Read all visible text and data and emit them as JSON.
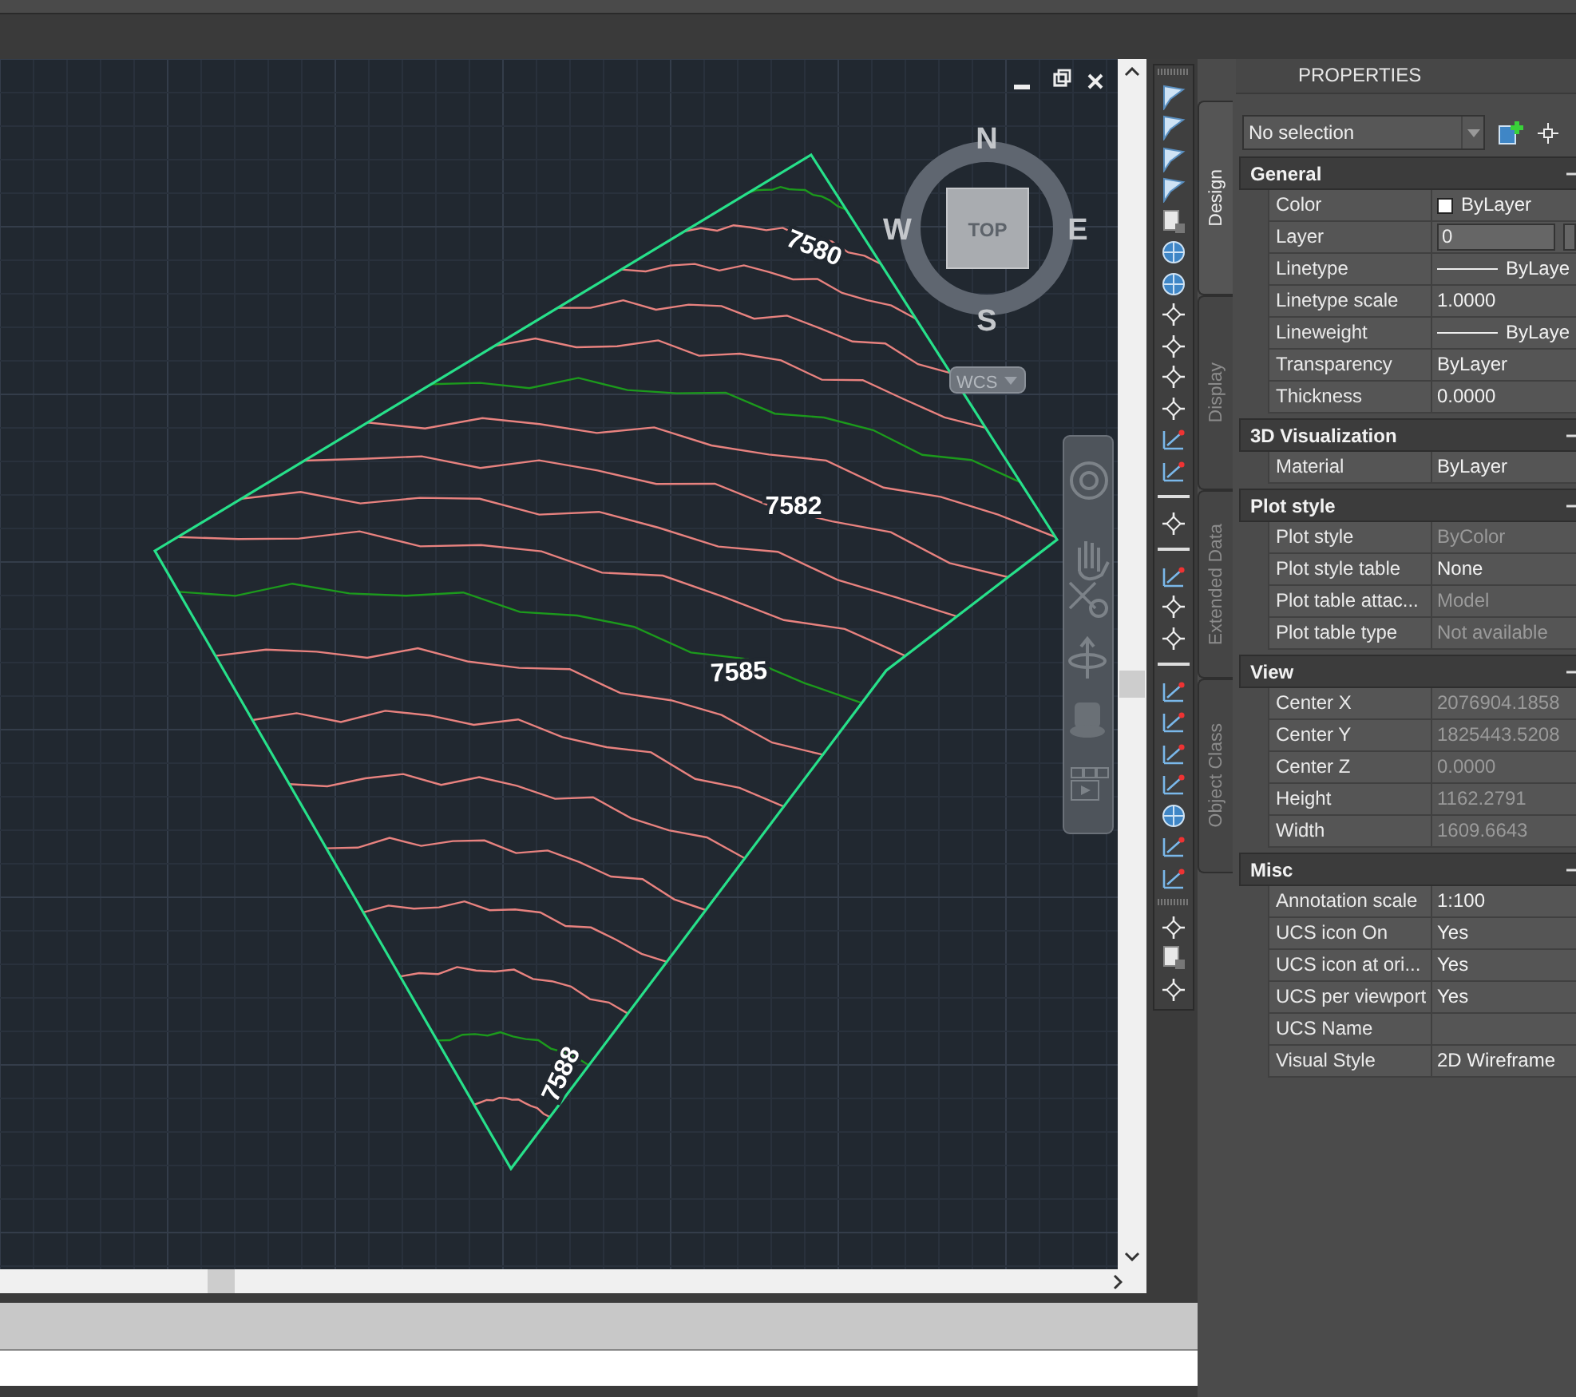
{
  "drawing": {
    "contour_labels": [
      "7580",
      "7582",
      "7585",
      "7588"
    ]
  },
  "viewcube": {
    "north": "N",
    "west": "W",
    "east": "E",
    "south": "S",
    "face": "TOP",
    "ucs_menu": "WCS"
  },
  "properties": {
    "title": "PROPERTIES",
    "selection": "No selection",
    "tabs": [
      {
        "label": "Design",
        "selected": true
      },
      {
        "label": "Display",
        "selected": false
      },
      {
        "label": "Extended Data",
        "selected": false
      },
      {
        "label": "Object Class",
        "selected": false
      }
    ],
    "sections": [
      {
        "title": "General",
        "expanded": true,
        "rows": [
          {
            "label": "Color",
            "value": "ByLayer",
            "kind": "swatch",
            "disabled": false
          },
          {
            "label": "Layer",
            "value": "0",
            "kind": "dropdown",
            "disabled": false
          },
          {
            "label": "Linetype",
            "value": "ByLaye",
            "kind": "line",
            "disabled": false
          },
          {
            "label": "Linetype scale",
            "value": "1.0000",
            "kind": "text",
            "disabled": false
          },
          {
            "label": "Lineweight",
            "value": "ByLaye",
            "kind": "line",
            "disabled": false
          },
          {
            "label": "Transparency",
            "value": "ByLayer",
            "kind": "text",
            "disabled": false
          },
          {
            "label": "Thickness",
            "value": "0.0000",
            "kind": "text",
            "disabled": false
          }
        ]
      },
      {
        "title": "3D Visualization",
        "expanded": true,
        "rows": [
          {
            "label": "Material",
            "value": "ByLayer",
            "kind": "text",
            "disabled": false
          }
        ]
      },
      {
        "title": "Plot style",
        "expanded": true,
        "rows": [
          {
            "label": "Plot style",
            "value": "ByColor",
            "kind": "text",
            "disabled": true
          },
          {
            "label": "Plot style table",
            "value": "None",
            "kind": "text",
            "disabled": false
          },
          {
            "label": "Plot table attac...",
            "value": "Model",
            "kind": "text",
            "disabled": true
          },
          {
            "label": "Plot table type",
            "value": "Not available",
            "kind": "text",
            "disabled": true
          }
        ]
      },
      {
        "title": "View",
        "expanded": true,
        "rows": [
          {
            "label": "Center X",
            "value": "2076904.1858",
            "kind": "text",
            "disabled": true
          },
          {
            "label": "Center Y",
            "value": "1825443.5208",
            "kind": "text",
            "disabled": true
          },
          {
            "label": "Center Z",
            "value": "0.0000",
            "kind": "text",
            "disabled": true
          },
          {
            "label": "Height",
            "value": "1162.2791",
            "kind": "text",
            "disabled": true
          },
          {
            "label": "Width",
            "value": "1609.6643",
            "kind": "text",
            "disabled": true
          }
        ]
      },
      {
        "title": "Misc",
        "expanded": true,
        "rows": [
          {
            "label": "Annotation scale",
            "value": "1:100",
            "kind": "text",
            "disabled": false
          },
          {
            "label": "UCS icon On",
            "value": "Yes",
            "kind": "text",
            "disabled": false
          },
          {
            "label": "UCS icon at ori...",
            "value": "Yes",
            "kind": "text",
            "disabled": false
          },
          {
            "label": "UCS per viewport",
            "value": "Yes",
            "kind": "text",
            "disabled": false
          },
          {
            "label": "UCS Name",
            "kind": "text",
            "disabled": false
          },
          {
            "label": "Visual Style",
            "value": "2D Wireframe",
            "kind": "text",
            "disabled": false
          }
        ]
      }
    ]
  }
}
